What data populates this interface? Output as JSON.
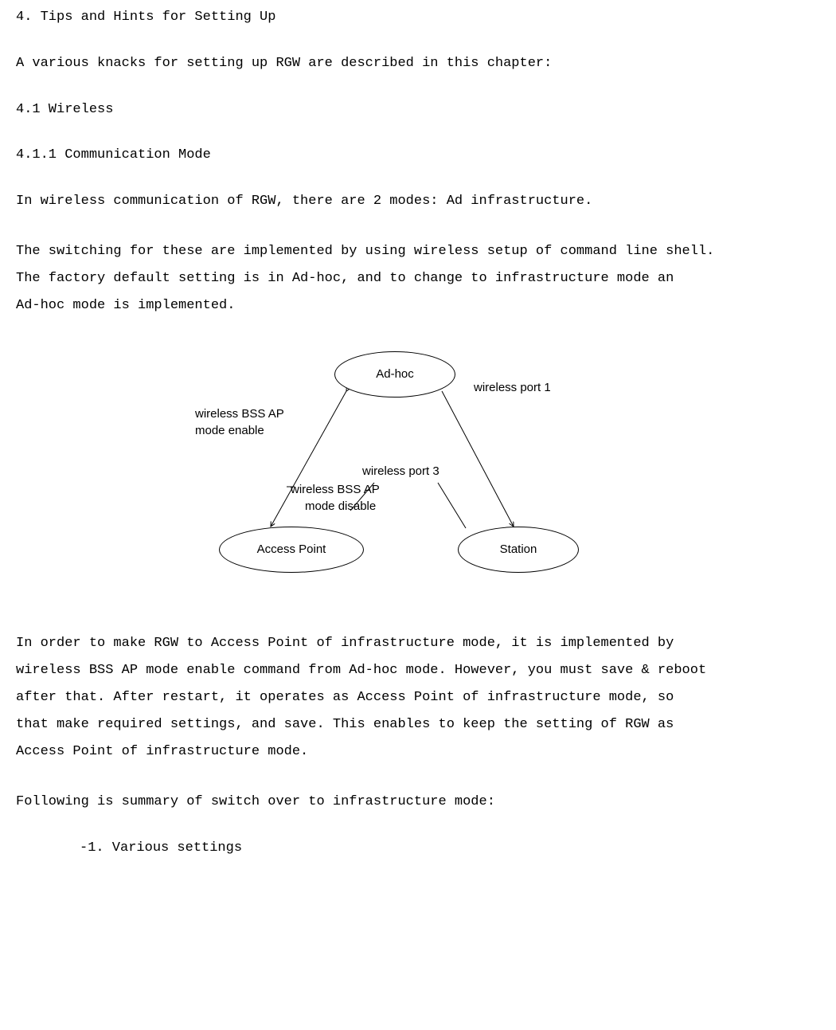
{
  "heading_main": "4. Tips and Hints for Setting Up",
  "intro": "A various knacks for setting up RGW are described in this chapter:",
  "section_1": "4.1 Wireless",
  "section_1_1": "4.1.1 Communication Mode",
  "para1": "In wireless communication of RGW, there are 2 modes: Ad infrastructure.",
  "para2_line1": "The switching for these are implemented by using wireless setup of command line shell.",
  "para2_line2": "The factory default setting is in Ad-hoc, and to change to infrastructure mode an",
  "para2_line3": "Ad-hoc mode is implemented.",
  "diagram": {
    "node_adhoc": "Ad-hoc",
    "node_ap": "Access Point",
    "node_station": "Station",
    "label_enable_l1": "wireless BSS AP",
    "label_enable_l2": "mode enable",
    "label_port1": "wireless port 1",
    "label_port3": "wireless port 3",
    "label_disable_l1": "wireless BSS AP",
    "label_disable_l2": "mode disable"
  },
  "para3_line1": "In order to make RGW to Access Point of infrastructure mode, it is implemented by",
  "para3_line2": "wireless BSS AP mode enable command from Ad-hoc mode. However, you must save & reboot",
  "para3_line3": "after that. After restart, it operates as Access Point of infrastructure mode, so",
  "para3_line4": "that make required settings, and save. This enables to keep the setting of RGW as",
  "para3_line5": "Access Point of infrastructure mode.",
  "para4": "Following is summary of switch over to infrastructure mode:",
  "list_item1": "-1. Various settings"
}
